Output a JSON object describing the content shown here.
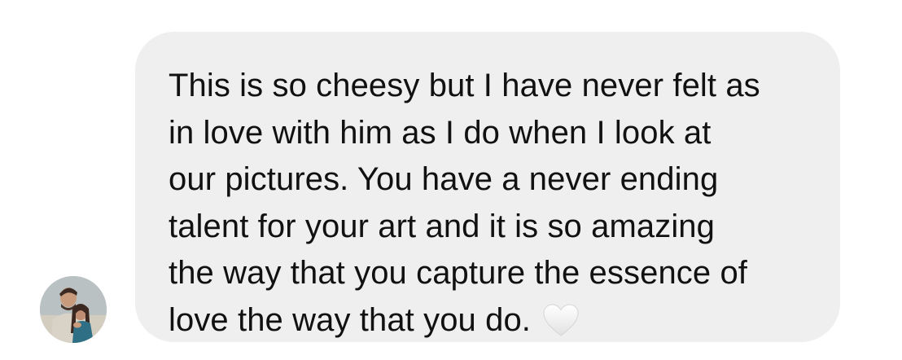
{
  "conversation": {
    "message": {
      "lines": [
        "This is so cheesy but I have never felt as",
        "in love with him as I do when I look at",
        "our pictures. You have a never ending",
        "talent for your art and it is so amazing",
        "the way that you capture the essence of",
        "love the way that you do."
      ],
      "emoji": "white-heart-icon"
    },
    "sender": {
      "avatar": "avatar-photo"
    },
    "colors": {
      "bubble": "#efefef",
      "text": "#111111",
      "background": "#ffffff"
    }
  }
}
